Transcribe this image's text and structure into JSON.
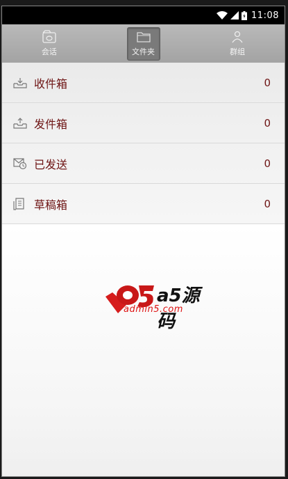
{
  "status_bar": {
    "time": "11:08",
    "icons": [
      "wifi-icon",
      "signal-icon",
      "battery-icon"
    ]
  },
  "tabs": [
    {
      "label": "会话",
      "icon": "chat-icon",
      "active": false
    },
    {
      "label": "文件夹",
      "icon": "folder-icon",
      "active": true
    },
    {
      "label": "群组",
      "icon": "person-icon",
      "active": false
    }
  ],
  "folders": [
    {
      "label": "收件箱",
      "count": "0",
      "icon": "inbox-icon"
    },
    {
      "label": "发件箱",
      "count": "0",
      "icon": "outbox-icon"
    },
    {
      "label": "已发送",
      "count": "0",
      "icon": "sent-icon"
    },
    {
      "label": "草稿箱",
      "count": "0",
      "icon": "drafts-icon"
    }
  ],
  "watermark": {
    "brand": "a5源码",
    "domain": "admin5.com"
  },
  "colors": {
    "label_text": "#6e1414",
    "tabbar_bg": "#b0b0b0",
    "active_tab_bg": "#7a7a7a"
  }
}
